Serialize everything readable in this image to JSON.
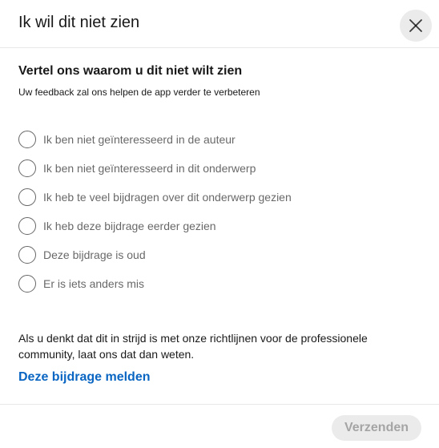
{
  "dialog": {
    "title": "Ik wil dit niet zien",
    "close_icon": "close-icon"
  },
  "body": {
    "title": "Vertel ons waarom u dit niet wilt zien",
    "subtitle": "Uw feedback zal ons helpen de app verder te verbeteren",
    "options": [
      {
        "label": "Ik ben niet geïnteresseerd in de auteur",
        "selected": false
      },
      {
        "label": "Ik ben niet geïnteresseerd in dit onderwerp",
        "selected": false
      },
      {
        "label": "Ik heb te veel bijdragen over dit onderwerp gezien",
        "selected": false
      },
      {
        "label": "Ik heb deze bijdrage eerder gezien",
        "selected": false
      },
      {
        "label": "Deze bijdrage is oud",
        "selected": false
      },
      {
        "label": "Er is iets anders mis",
        "selected": false
      }
    ],
    "notice": "Als u denkt dat dit in strijd is met onze richtlijnen voor de professionele community, laat ons dat dan weten.",
    "report_link": "Deze bijdrage melden"
  },
  "footer": {
    "submit_label": "Verzenden",
    "submit_enabled": false
  },
  "colors": {
    "link": "#0a66c2",
    "disabled_bg": "#ebebeb"
  }
}
